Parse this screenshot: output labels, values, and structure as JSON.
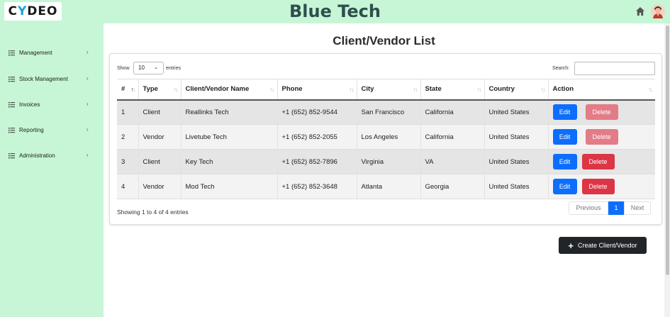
{
  "header": {
    "logo_text_left": "C",
    "logo_text_y": "Y",
    "logo_text_right": "DEO",
    "title": "Blue Tech"
  },
  "sidebar": {
    "items": [
      {
        "label": "Management",
        "icon": "list-icon"
      },
      {
        "label": "Stock Management",
        "icon": "list-icon"
      },
      {
        "label": "Invoices",
        "icon": "list-icon"
      },
      {
        "label": "Reporting",
        "icon": "list-icon"
      },
      {
        "label": "Administration",
        "icon": "list-icon"
      }
    ]
  },
  "main": {
    "title": "Client/Vendor List",
    "show_label": "Show",
    "entries_value": "10",
    "entries_label": "entries",
    "search_label": "Search:",
    "search_value": "",
    "columns": [
      "#",
      "Type",
      "Client/Vendor Name",
      "Phone",
      "City",
      "State",
      "Country",
      "Action"
    ],
    "rows": [
      {
        "num": "1",
        "type": "Client",
        "name": "Reallinks Tech",
        "phone": "+1 (652) 852-9544",
        "city": "San Francisco",
        "state": "California",
        "country": "United States",
        "edit": "Edit",
        "delete": "Delete",
        "delete_disabled": true
      },
      {
        "num": "2",
        "type": "Vendor",
        "name": "Livetube Tech",
        "phone": "+1 (652) 852-2055",
        "city": "Los Angeles",
        "state": "California",
        "country": "United States",
        "edit": "Edit",
        "delete": "Delete",
        "delete_disabled": true
      },
      {
        "num": "3",
        "type": "Client",
        "name": "Key Tech",
        "phone": "+1 (652) 852-7896",
        "city": "Virginia",
        "state": "VA",
        "country": "United States",
        "edit": "Edit",
        "delete": "Delete",
        "delete_disabled": false
      },
      {
        "num": "4",
        "type": "Vendor",
        "name": "Mod Tech",
        "phone": "+1 (652) 852-3648",
        "city": "Atlanta",
        "state": "Georgia",
        "country": "United States",
        "edit": "Edit",
        "delete": "Delete",
        "delete_disabled": false
      }
    ],
    "info": "Showing 1 to 4 of 4 entries",
    "pager": {
      "previous": "Previous",
      "current": "1",
      "next": "Next"
    },
    "create_button": "Create Client/Vendor"
  },
  "colors": {
    "header_bg": "#c6f6d5",
    "primary": "#0d6efd",
    "danger": "#dc3545",
    "dark": "#212529"
  }
}
